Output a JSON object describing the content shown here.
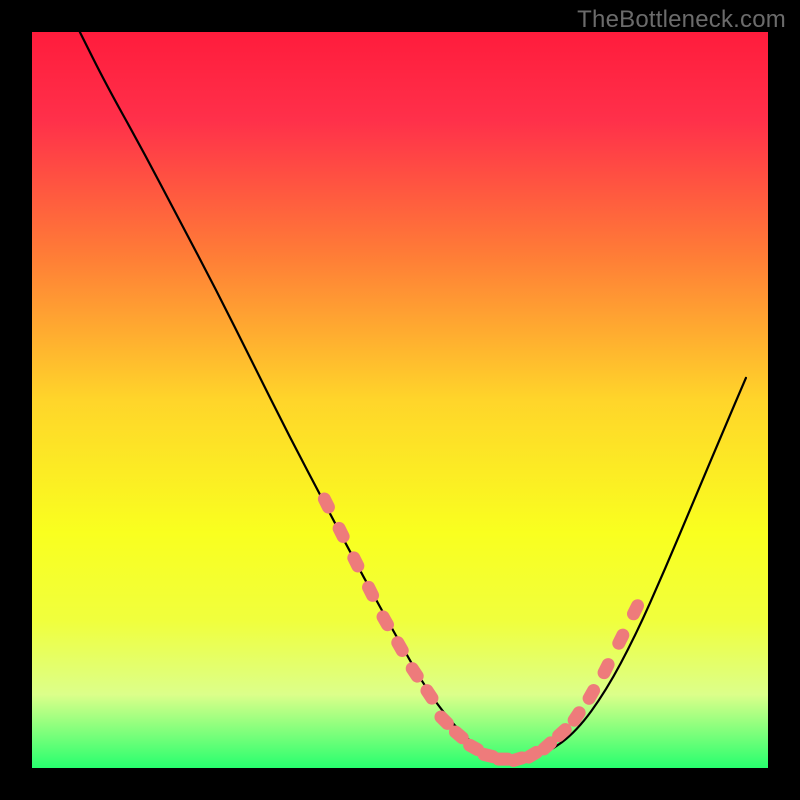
{
  "watermark": "TheBottleneck.com",
  "chart_data": {
    "type": "line",
    "title": "",
    "xlabel": "",
    "ylabel": "",
    "xlim": [
      0,
      100
    ],
    "ylim": [
      0,
      100
    ],
    "gradient_stops": [
      {
        "offset": 0,
        "color": "#ff1c3c"
      },
      {
        "offset": 12,
        "color": "#ff304a"
      },
      {
        "offset": 30,
        "color": "#ff7b37"
      },
      {
        "offset": 50,
        "color": "#ffd52a"
      },
      {
        "offset": 68,
        "color": "#f9ff1f"
      },
      {
        "offset": 80,
        "color": "#f0ff3d"
      },
      {
        "offset": 90,
        "color": "#dcff8a"
      },
      {
        "offset": 100,
        "color": "#27ff6e"
      }
    ],
    "series": [
      {
        "name": "bottleneck-curve",
        "color": "#000000",
        "x": [
          6.5,
          10,
          15,
          20,
          25,
          30,
          35,
          40,
          45,
          50,
          54,
          58,
          62,
          66,
          70,
          74,
          78,
          82,
          86,
          90,
          94,
          97
        ],
        "y": [
          100,
          93,
          84,
          74.5,
          65,
          55,
          45,
          35.5,
          26,
          17,
          10,
          5,
          1.5,
          1,
          2,
          5,
          10.5,
          18,
          27,
          36.5,
          46,
          53
        ]
      },
      {
        "name": "optimal-markers-left",
        "color": "#ee7b7b",
        "type": "scatter",
        "x": [
          40,
          42,
          44,
          46,
          48,
          50,
          52,
          54
        ],
        "y": [
          36,
          32,
          28,
          24,
          20,
          16.5,
          13,
          10
        ]
      },
      {
        "name": "optimal-markers-bottom",
        "color": "#ee7b7b",
        "type": "scatter",
        "x": [
          56,
          58,
          60,
          62,
          64,
          66,
          68,
          70,
          72
        ],
        "y": [
          6.5,
          4.5,
          2.8,
          1.7,
          1.2,
          1.2,
          1.8,
          3,
          4.8
        ]
      },
      {
        "name": "optimal-markers-right",
        "color": "#ee7b7b",
        "type": "scatter",
        "x": [
          74,
          76,
          78,
          80,
          82
        ],
        "y": [
          7,
          10,
          13.5,
          17.5,
          21.5
        ]
      }
    ]
  }
}
